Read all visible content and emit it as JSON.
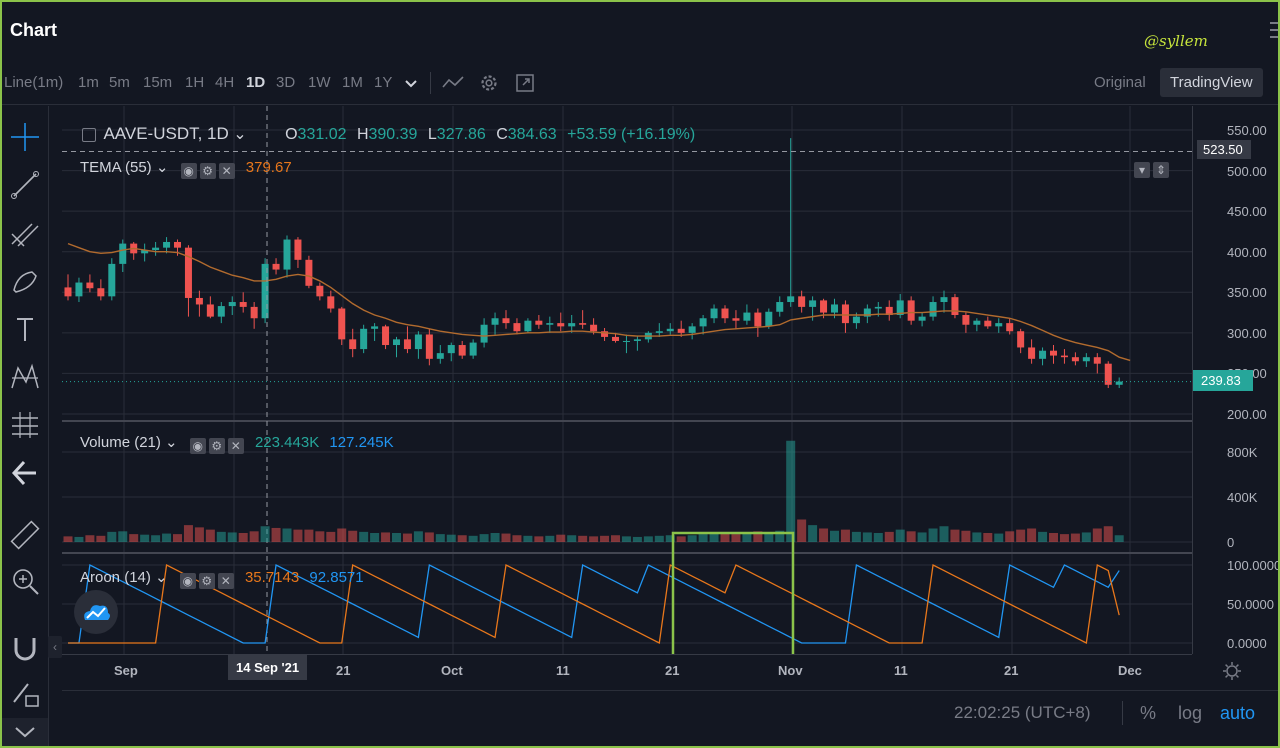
{
  "app": {
    "title": "Chart",
    "watermark": "@syllem"
  },
  "toolbar": {
    "intervals": [
      "Line(1m)",
      "1m",
      "5m",
      "15m",
      "1H",
      "4H",
      "1D",
      "3D",
      "1W",
      "1M",
      "1Y"
    ],
    "active_interval": "1D",
    "view_original": "Original",
    "view_tradingview": "TradingView"
  },
  "legend": {
    "symbol": "AAVE-USDT, 1D",
    "o_label": "O",
    "o_value": "331.02",
    "h_label": "H",
    "h_value": "390.39",
    "l_label": "L",
    "l_value": "327.86",
    "c_label": "C",
    "c_value": "384.63",
    "change": "+53.59 (+16.19%)"
  },
  "indicators": {
    "tema": {
      "label": "TEMA (55)",
      "value": "379.67"
    },
    "volume": {
      "label": "Volume (21)",
      "value1": "223.443K",
      "value2": "127.245K"
    },
    "aroon": {
      "label": "Aroon (14)",
      "up_value": "35.7143",
      "down_value": "92.8571"
    }
  },
  "price_axis": {
    "labels": [
      "550.00",
      "500.00",
      "450.00",
      "400.00",
      "350.00",
      "300.00",
      "250.00",
      "200.00"
    ],
    "crosshair_price": "523.50",
    "last_price": "239.83",
    "volume_labels": [
      "800K",
      "400K",
      "0"
    ],
    "aroon_labels": [
      "100.0000",
      "50.0000",
      "0.0000"
    ]
  },
  "time_axis": {
    "labels": [
      "Sep",
      "21",
      "Oct",
      "11",
      "21",
      "Nov",
      "11",
      "21",
      "Dec"
    ],
    "crosshair_date": "14 Sep '21"
  },
  "bottom": {
    "clock": "22:02:25 (UTC+8)",
    "percent": "%",
    "log": "log",
    "auto": "auto"
  },
  "colors": {
    "up": "#26a69a",
    "down": "#ef5350",
    "tema": "#b26b2e",
    "aroon_up": "#e8771b",
    "aroon_down": "#2196f3",
    "highlight": "#8bc34a"
  },
  "chart_data": {
    "type": "candlestick",
    "symbol": "AAVE-USDT",
    "interval": "1D",
    "x_range": [
      "2021-08-28",
      "2021-11-27"
    ],
    "price_ylim": [
      200,
      550
    ],
    "candles": [
      [
        356,
        372,
        340,
        345
      ],
      [
        345,
        368,
        338,
        362
      ],
      [
        362,
        372,
        350,
        355
      ],
      [
        355,
        366,
        340,
        345
      ],
      [
        345,
        392,
        340,
        385
      ],
      [
        385,
        415,
        375,
        410
      ],
      [
        410,
        412,
        390,
        398
      ],
      [
        398,
        410,
        388,
        402
      ],
      [
        402,
        412,
        395,
        405
      ],
      [
        405,
        418,
        398,
        412
      ],
      [
        412,
        415,
        395,
        405
      ],
      [
        405,
        408,
        320,
        343
      ],
      [
        343,
        352,
        320,
        335
      ],
      [
        335,
        345,
        318,
        320
      ],
      [
        320,
        338,
        312,
        333
      ],
      [
        333,
        345,
        322,
        338
      ],
      [
        338,
        350,
        325,
        332
      ],
      [
        332,
        338,
        305,
        318
      ],
      [
        318,
        392,
        312,
        385
      ],
      [
        385,
        392,
        372,
        378
      ],
      [
        378,
        420,
        368,
        415
      ],
      [
        415,
        418,
        380,
        390
      ],
      [
        390,
        395,
        355,
        358
      ],
      [
        358,
        362,
        340,
        345
      ],
      [
        345,
        352,
        325,
        330
      ],
      [
        330,
        332,
        285,
        292
      ],
      [
        292,
        305,
        270,
        280
      ],
      [
        280,
        310,
        275,
        305
      ],
      [
        305,
        312,
        290,
        308
      ],
      [
        308,
        310,
        280,
        285
      ],
      [
        285,
        295,
        270,
        292
      ],
      [
        292,
        308,
        275,
        280
      ],
      [
        280,
        302,
        268,
        298
      ],
      [
        298,
        305,
        260,
        268
      ],
      [
        268,
        285,
        262,
        275
      ],
      [
        275,
        288,
        265,
        285
      ],
      [
        285,
        290,
        268,
        272
      ],
      [
        272,
        292,
        268,
        288
      ],
      [
        288,
        318,
        282,
        310
      ],
      [
        310,
        325,
        298,
        318
      ],
      [
        318,
        328,
        305,
        312
      ],
      [
        312,
        318,
        298,
        302
      ],
      [
        302,
        318,
        300,
        315
      ],
      [
        315,
        322,
        305,
        310
      ],
      [
        310,
        320,
        300,
        312
      ],
      [
        312,
        325,
        302,
        308
      ],
      [
        308,
        322,
        300,
        312
      ],
      [
        312,
        328,
        305,
        310
      ],
      [
        310,
        318,
        298,
        302
      ],
      [
        302,
        306,
        290,
        295
      ],
      [
        295,
        300,
        288,
        290
      ],
      [
        290,
        298,
        275,
        290
      ],
      [
        290,
        296,
        278,
        292
      ],
      [
        292,
        302,
        288,
        300
      ],
      [
        300,
        312,
        295,
        302
      ],
      [
        302,
        312,
        298,
        305
      ],
      [
        305,
        315,
        295,
        300
      ],
      [
        300,
        312,
        292,
        308
      ],
      [
        308,
        322,
        298,
        318
      ],
      [
        318,
        335,
        312,
        330
      ],
      [
        330,
        334,
        312,
        318
      ],
      [
        318,
        328,
        305,
        315
      ],
      [
        315,
        335,
        310,
        325
      ],
      [
        325,
        330,
        295,
        308
      ],
      [
        308,
        330,
        305,
        326
      ],
      [
        326,
        345,
        320,
        338
      ],
      [
        338,
        540,
        332,
        345
      ],
      [
        345,
        352,
        325,
        332
      ],
      [
        332,
        345,
        315,
        340
      ],
      [
        340,
        342,
        318,
        325
      ],
      [
        325,
        342,
        318,
        335
      ],
      [
        335,
        340,
        300,
        312
      ],
      [
        312,
        325,
        305,
        320
      ],
      [
        320,
        335,
        312,
        330
      ],
      [
        330,
        338,
        320,
        332
      ],
      [
        332,
        340,
        315,
        322
      ],
      [
        322,
        348,
        318,
        340
      ],
      [
        340,
        345,
        310,
        315
      ],
      [
        315,
        325,
        308,
        320
      ],
      [
        320,
        345,
        315,
        338
      ],
      [
        338,
        352,
        325,
        344
      ],
      [
        344,
        348,
        318,
        322
      ],
      [
        322,
        325,
        300,
        310
      ],
      [
        310,
        318,
        302,
        315
      ],
      [
        315,
        320,
        305,
        308
      ],
      [
        308,
        318,
        300,
        312
      ],
      [
        312,
        318,
        298,
        302
      ],
      [
        302,
        305,
        275,
        282
      ],
      [
        282,
        292,
        262,
        268
      ],
      [
        268,
        282,
        260,
        278
      ],
      [
        278,
        285,
        262,
        272
      ],
      [
        272,
        280,
        262,
        270
      ],
      [
        270,
        276,
        260,
        265
      ],
      [
        265,
        275,
        258,
        270
      ],
      [
        270,
        275,
        250,
        262
      ],
      [
        262,
        265,
        232,
        236
      ],
      [
        236,
        245,
        232,
        240
      ]
    ],
    "tema": [
      410,
      405,
      400,
      398,
      399,
      402,
      404,
      402,
      400,
      400,
      399,
      394,
      388,
      381,
      376,
      371,
      368,
      364,
      364,
      366,
      370,
      372,
      370,
      364,
      356,
      346,
      336,
      328,
      322,
      318,
      313,
      310,
      308,
      305,
      302,
      300,
      298,
      297,
      296,
      297,
      298,
      299,
      300,
      300,
      301,
      301,
      302,
      302,
      301,
      300,
      299,
      297,
      296,
      296,
      296,
      297,
      297,
      298,
      300,
      302,
      304,
      305,
      306,
      307,
      308,
      310,
      316,
      318,
      320,
      322,
      322,
      322,
      322,
      322,
      323,
      323,
      324,
      325,
      325,
      326,
      327,
      327,
      326,
      324,
      322,
      320,
      318,
      314,
      309,
      303,
      297,
      292,
      288,
      285,
      282,
      278,
      270,
      266
    ],
    "volume_k": [
      50,
      45,
      60,
      55,
      90,
      95,
      70,
      65,
      60,
      75,
      70,
      150,
      130,
      110,
      90,
      85,
      80,
      95,
      140,
      125,
      120,
      110,
      110,
      95,
      90,
      120,
      100,
      90,
      80,
      85,
      80,
      75,
      95,
      85,
      70,
      65,
      60,
      55,
      70,
      80,
      75,
      60,
      55,
      50,
      55,
      65,
      60,
      55,
      50,
      55,
      60,
      50,
      45,
      50,
      55,
      60,
      50,
      60,
      70,
      80,
      75,
      70,
      85,
      95,
      80,
      100,
      900,
      200,
      150,
      120,
      100,
      110,
      90,
      85,
      80,
      90,
      110,
      95,
      85,
      120,
      140,
      110,
      100,
      85,
      80,
      75,
      95,
      110,
      120,
      90,
      80,
      70,
      75,
      85,
      120,
      140,
      60
    ],
    "aroon_up_end": 35.7143,
    "aroon_down_end": 92.8571
  }
}
